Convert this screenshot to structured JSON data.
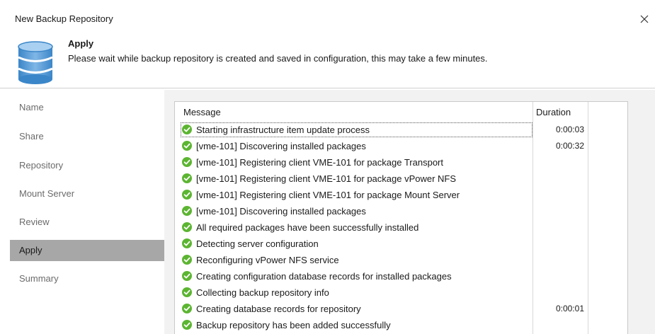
{
  "window": {
    "title": "New Backup Repository",
    "close_glyph": "✕"
  },
  "header": {
    "icon": "database-icon",
    "step_title": "Apply",
    "step_description": "Please wait while backup repository is created and saved in configuration, this may take a few minutes."
  },
  "sidebar": {
    "items": [
      {
        "label": "Name",
        "active": false
      },
      {
        "label": "Share",
        "active": false
      },
      {
        "label": "Repository",
        "active": false
      },
      {
        "label": "Mount Server",
        "active": false
      },
      {
        "label": "Review",
        "active": false
      },
      {
        "label": "Apply",
        "active": true
      },
      {
        "label": "Summary",
        "active": false
      }
    ]
  },
  "log": {
    "columns": {
      "message": "Message",
      "duration": "Duration"
    },
    "status_icon": "check-circle-icon",
    "status_color": "#5cb531",
    "rows": [
      {
        "message": "Starting infrastructure item update process",
        "duration": "0:00:03",
        "selected": true
      },
      {
        "message": "[vme-101] Discovering installed packages",
        "duration": "0:00:32"
      },
      {
        "message": "[vme-101] Registering client VME-101 for package Transport",
        "duration": ""
      },
      {
        "message": "[vme-101] Registering client VME-101 for package vPower NFS",
        "duration": ""
      },
      {
        "message": "[vme-101] Registering client VME-101 for package Mount Server",
        "duration": ""
      },
      {
        "message": "[vme-101] Discovering installed packages",
        "duration": ""
      },
      {
        "message": "All required packages have been successfully installed",
        "duration": ""
      },
      {
        "message": "Detecting server configuration",
        "duration": ""
      },
      {
        "message": "Reconfiguring vPower NFS service",
        "duration": ""
      },
      {
        "message": "Creating configuration database records for installed packages",
        "duration": ""
      },
      {
        "message": "Collecting backup repository info",
        "duration": ""
      },
      {
        "message": "Creating database records for repository",
        "duration": "0:00:01"
      },
      {
        "message": "Backup repository has been added successfully",
        "duration": ""
      }
    ]
  }
}
